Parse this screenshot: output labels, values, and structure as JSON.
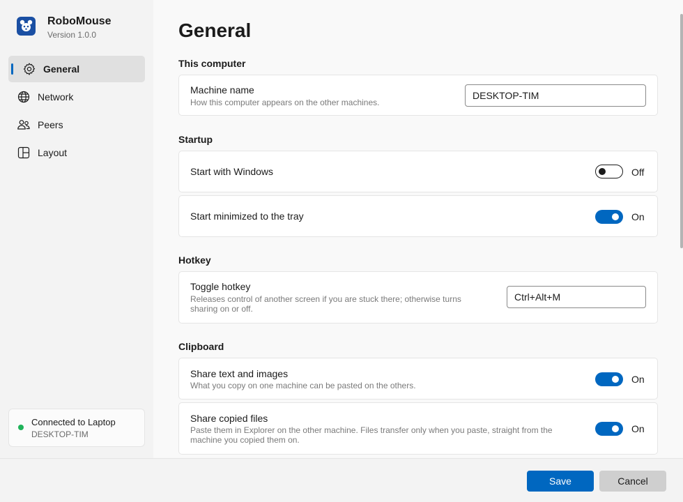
{
  "app": {
    "name": "RoboMouse",
    "version": "Version 1.0.0"
  },
  "nav": {
    "items": [
      {
        "label": "General",
        "icon": "gear-icon",
        "active": true
      },
      {
        "label": "Network",
        "icon": "globe-icon",
        "active": false
      },
      {
        "label": "Peers",
        "icon": "people-icon",
        "active": false
      },
      {
        "label": "Layout",
        "icon": "layout-icon",
        "active": false
      }
    ]
  },
  "status": {
    "title": "Connected to Laptop",
    "subtitle": "DESKTOP-TIM",
    "color": "#1fb35a"
  },
  "page": {
    "title": "General"
  },
  "sections": {
    "computer": {
      "title": "This computer",
      "machine_name": {
        "label": "Machine name",
        "description": "How this computer appears on the other machines.",
        "value": "DESKTOP-TIM"
      }
    },
    "startup": {
      "title": "Startup",
      "start_with_windows": {
        "label": "Start with Windows",
        "state": "Off"
      },
      "start_minimized": {
        "label": "Start minimized to the tray",
        "state": "On"
      }
    },
    "hotkey": {
      "title": "Hotkey",
      "toggle_hotkey": {
        "label": "Toggle hotkey",
        "description_line1": "Releases control of another screen if you are stuck there; otherwise turns",
        "description_line2": "sharing on or off.",
        "value": "Ctrl+Alt+M"
      }
    },
    "clipboard": {
      "title": "Clipboard",
      "share_text": {
        "label": "Share text and images",
        "description": "What you copy on one machine can be pasted on the others.",
        "state": "On"
      },
      "share_files": {
        "label": "Share copied files",
        "description_line1": "Paste them in Explorer on the other machine. Files transfer only when you paste, straight from the",
        "description_line2": "machine you copied them on.",
        "state": "On"
      }
    }
  },
  "footer": {
    "save_label": "Save",
    "cancel_label": "Cancel"
  },
  "colors": {
    "accent": "#0067c0",
    "brand": "#1a4fa3"
  }
}
